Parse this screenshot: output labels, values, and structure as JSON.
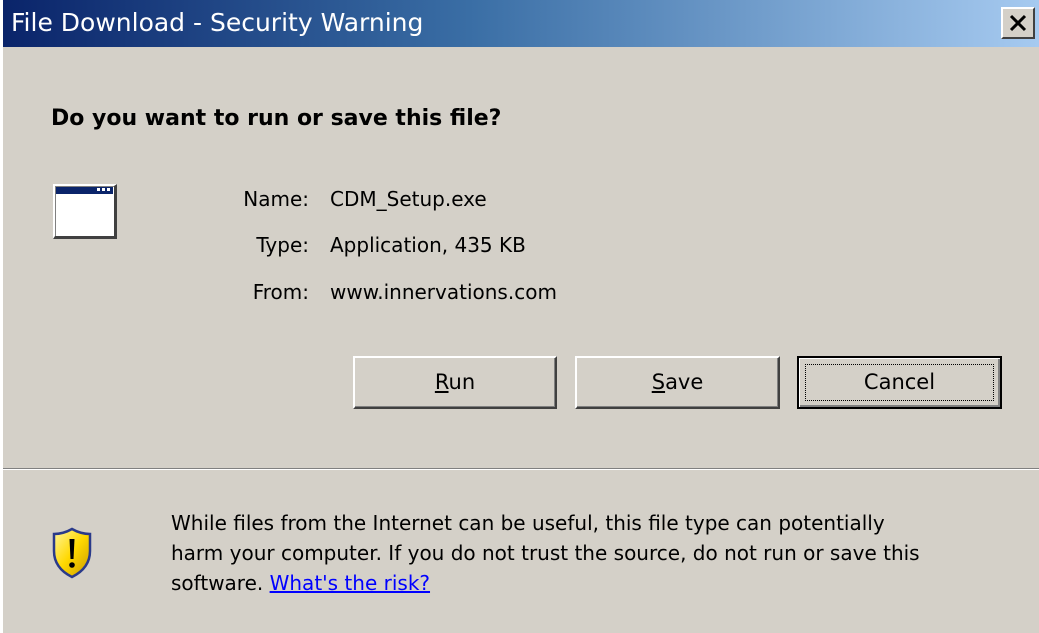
{
  "window": {
    "title": "File Download - Security Warning",
    "close_label": "X"
  },
  "prompt": {
    "question": "Do you want to run or save this file?"
  },
  "file_info": {
    "name_label": "Name:",
    "name_value": "CDM_Setup.exe",
    "type_label": "Type:",
    "type_value": "Application, 435 KB",
    "from_label": "From:",
    "from_value": "www.innervations.com"
  },
  "buttons": {
    "run": {
      "accel": "R",
      "rest": "un"
    },
    "save": {
      "accel": "S",
      "rest": "ave"
    },
    "cancel": {
      "label": "Cancel"
    }
  },
  "warning": {
    "line1": "While files from the Internet can be useful, this file type can potentially",
    "line2": "harm your computer. If you do not trust the source, do not run or save this",
    "line3_prefix": "software. ",
    "risk_link": "What's the risk?"
  },
  "icons": {
    "app": "application-window-icon",
    "shield": "security-shield-warning-icon"
  },
  "colors": {
    "dialog_bg": "#d4d0c8",
    "title_start": "#0a246a",
    "title_end": "#a6caf0",
    "link": "#0000ff",
    "shield_yellow": "#ffd800"
  }
}
